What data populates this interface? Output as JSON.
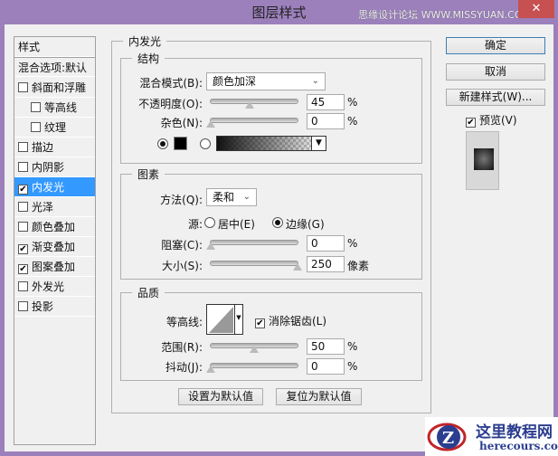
{
  "window": {
    "title": "图层样式",
    "watermark": "思缘设计论坛 WWW.MISSYUAN.COM",
    "close": "✕"
  },
  "sidebar": {
    "header": "样式",
    "blend_options": "混合选项:默认",
    "items": [
      {
        "label": "斜面和浮雕",
        "checked": false,
        "indent": false
      },
      {
        "label": "等高线",
        "checked": false,
        "indent": true
      },
      {
        "label": "纹理",
        "checked": false,
        "indent": true
      },
      {
        "label": "描边",
        "checked": false,
        "indent": false
      },
      {
        "label": "内阴影",
        "checked": false,
        "indent": false
      },
      {
        "label": "内发光",
        "checked": true,
        "indent": false,
        "selected": true
      },
      {
        "label": "光泽",
        "checked": false,
        "indent": false
      },
      {
        "label": "颜色叠加",
        "checked": false,
        "indent": false
      },
      {
        "label": "渐变叠加",
        "checked": true,
        "indent": false
      },
      {
        "label": "图案叠加",
        "checked": true,
        "indent": false
      },
      {
        "label": "外发光",
        "checked": false,
        "indent": false
      },
      {
        "label": "投影",
        "checked": false,
        "indent": false
      }
    ]
  },
  "panel": {
    "title": "内发光",
    "structure": {
      "title": "结构",
      "blend_mode_label": "混合模式(B):",
      "blend_mode": "颜色加深",
      "opacity_label": "不透明度(O):",
      "opacity": "45",
      "noise_label": "杂色(N):",
      "noise": "0",
      "percent": "%",
      "color": "#000000"
    },
    "elements": {
      "title": "图素",
      "technique_label": "方法(Q):",
      "technique": "柔和",
      "source_label": "源:",
      "source_center": "居中(E)",
      "source_edge": "边缘(G)",
      "choke_label": "阻塞(C):",
      "choke": "0",
      "size_label": "大小(S):",
      "size": "250",
      "size_unit": "像素",
      "percent": "%"
    },
    "quality": {
      "title": "品质",
      "contour_label": "等高线:",
      "antialias": "消除锯齿(L)",
      "range_label": "范围(R):",
      "range": "50",
      "jitter_label": "抖动(J):",
      "jitter": "0",
      "percent": "%"
    },
    "make_default": "设置为默认值",
    "reset_default": "复位为默认值"
  },
  "right": {
    "ok": "确定",
    "cancel": "取消",
    "new_style": "新建样式(W)...",
    "preview": "预览(V)"
  },
  "logo": {
    "name": "这里教程网",
    "url": "herecours.com"
  }
}
